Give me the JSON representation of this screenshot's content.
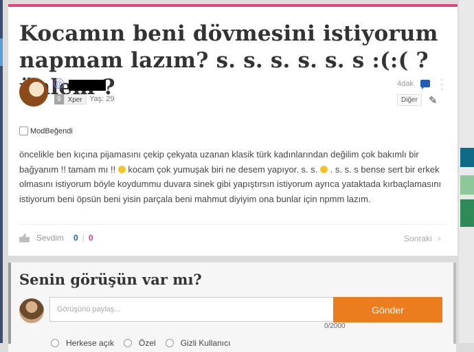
{
  "post": {
    "title": "Kocamın beni dövmesini istiyorum napmam lazım? s. s. s. s. s. s :(:( ? ünlem ?",
    "author": {
      "level": "9",
      "rank": "Xper",
      "age": "Yaş: 29"
    },
    "time": "4dak",
    "more_label": "Diğer",
    "mod_label": "ModBeğendi",
    "body": {
      "p1": "öncelikle ben kıçına pijamasını çekip çekyata uzanan klasik türk kadınlarından değilim çok bakımlı bir bağyanım !! tamam mı !! ",
      "p2": " kocam çok yumuşak biri ne desem yapıyor. s. s. ",
      "p3": " . s. s. s bense sert bir erkek olmasını istiyorum böyle koydummu duvara sinek gibi yapıştırsın istiyorum ayrıca yataktada kırbaçlamasını istiyorum beni öpsün beni yisin parçala beni mahmut diyiyim ona bunlar için npmm lazım."
    },
    "like_label": "Sevdim",
    "like_count": "0",
    "dislike_count": "0",
    "next_label": "Sonraki"
  },
  "comment": {
    "heading": "Senin görüşün var mı?",
    "placeholder": "Görüşünü paylaş...",
    "counter": "0/2000",
    "send_label": "Gönder",
    "options": [
      "Herkese açık",
      "Özel",
      "Gizli Kullanıcı"
    ]
  },
  "colors": {
    "accent_pink": "#e0447a",
    "accent_blue": "#1f5db4",
    "send_orange": "#ec7d1e"
  }
}
